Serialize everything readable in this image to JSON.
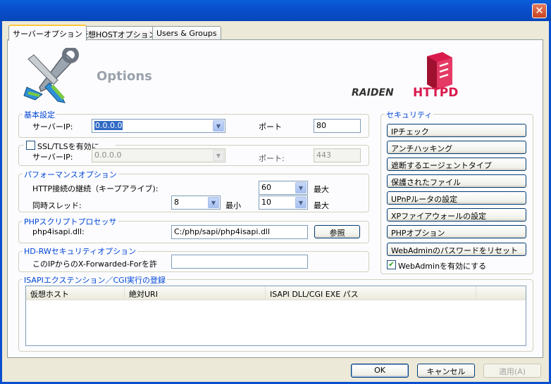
{
  "tabs": [
    "サーバーオプション",
    "仮想HOSTオプション",
    "Users & Groups"
  ],
  "header": {
    "title": "Options",
    "logo_left": "RAIDEN",
    "logo_right": "HTTPD"
  },
  "basic": {
    "legend": "基本設定",
    "server_ip_label": "サーバーIP:",
    "server_ip_value": "0.0.0.0",
    "port_label": "ポート",
    "port_value": "80"
  },
  "ssl": {
    "checkbox_label": "SSL/TLSを有効に",
    "server_ip_label": "サーバーIP:",
    "server_ip_value": "0.0.0.0",
    "port_label": "ポート:",
    "port_value": "443"
  },
  "performance": {
    "legend": "パフォーマンスオプション",
    "keepalive_label": "HTTP接続の継続（キープアライブ):",
    "keepalive_value": "60",
    "max_label": "最大",
    "threads_label": "同時スレッド:",
    "threads_min_value": "8",
    "min_label": "最小",
    "threads_max_value": "10",
    "max_label2": "最大"
  },
  "php": {
    "legend": "PHPスクリプトプロセッサ",
    "dll_label": "php4isapi.dll:",
    "dll_value": "C:/php/sapi/php4isapi.dll",
    "browse_label": "参照"
  },
  "hdrw": {
    "legend": "HD-RWセキュリティオプション",
    "xff_label": "このIPからのX-Forwarded-Forを許",
    "xff_value": ""
  },
  "security": {
    "legend": "セキュリティ",
    "buttons": [
      "IPチェック",
      "アンチハッキング",
      "遮断するエージェントタイプ",
      "保護されたファイル",
      "UPnPルータの設定",
      "XPファイアウォールの設定",
      "PHPオプション",
      "WebAdminのパスワードをリセット"
    ],
    "webadmin_checkbox_label": "WebAdminを有効にする",
    "webadmin_checked": true
  },
  "isapi": {
    "legend": "ISAPIエクステンション／CGI実行の登録",
    "columns": [
      "仮想ホスト",
      "絶対URI",
      "ISAPI DLL/CGI EXE パス"
    ],
    "rows": []
  },
  "footer": {
    "ok": "OK",
    "cancel": "キャンセル",
    "apply": "適用(A)"
  },
  "colors": {
    "titlebar": "#0a4fcf",
    "legend": "#0046d5",
    "selection": "#316ac5"
  }
}
